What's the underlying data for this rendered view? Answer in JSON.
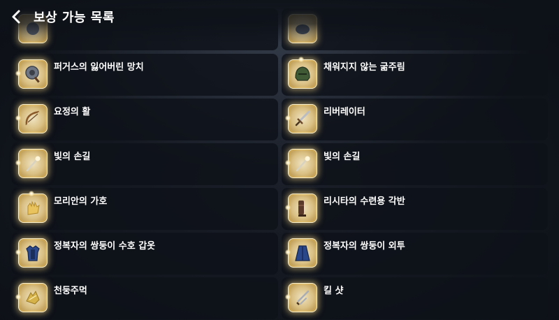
{
  "header": {
    "title": "보상 가능 목록",
    "back_icon": "chevron-left-icon"
  },
  "rewards": [
    {
      "name": "",
      "icon": "item-icon-partial"
    },
    {
      "name": "",
      "icon": "item-icon-partial"
    },
    {
      "name": "퍼거스의 잃어버린 망치",
      "icon": "hammer-icon"
    },
    {
      "name": "채워지지 않는 굶주림",
      "icon": "helmet-icon"
    },
    {
      "name": "요정의 활",
      "icon": "bow-icon"
    },
    {
      "name": "리버레이터",
      "icon": "sword-icon"
    },
    {
      "name": "빛의 손길",
      "icon": "staff-icon"
    },
    {
      "name": "빛의 손길",
      "icon": "staff-icon"
    },
    {
      "name": "모리안의 가호",
      "icon": "glove-icon"
    },
    {
      "name": "리시타의 수련용 각반",
      "icon": "greaves-icon"
    },
    {
      "name": "정복자의 쌍둥이 수호 갑옷",
      "icon": "armor-icon"
    },
    {
      "name": "정복자의 쌍둥이 외투",
      "icon": "cloak-icon"
    },
    {
      "name": "천둥주먹",
      "icon": "knuckle-icon"
    },
    {
      "name": "킬 샷",
      "icon": "dagger-icon"
    }
  ]
}
